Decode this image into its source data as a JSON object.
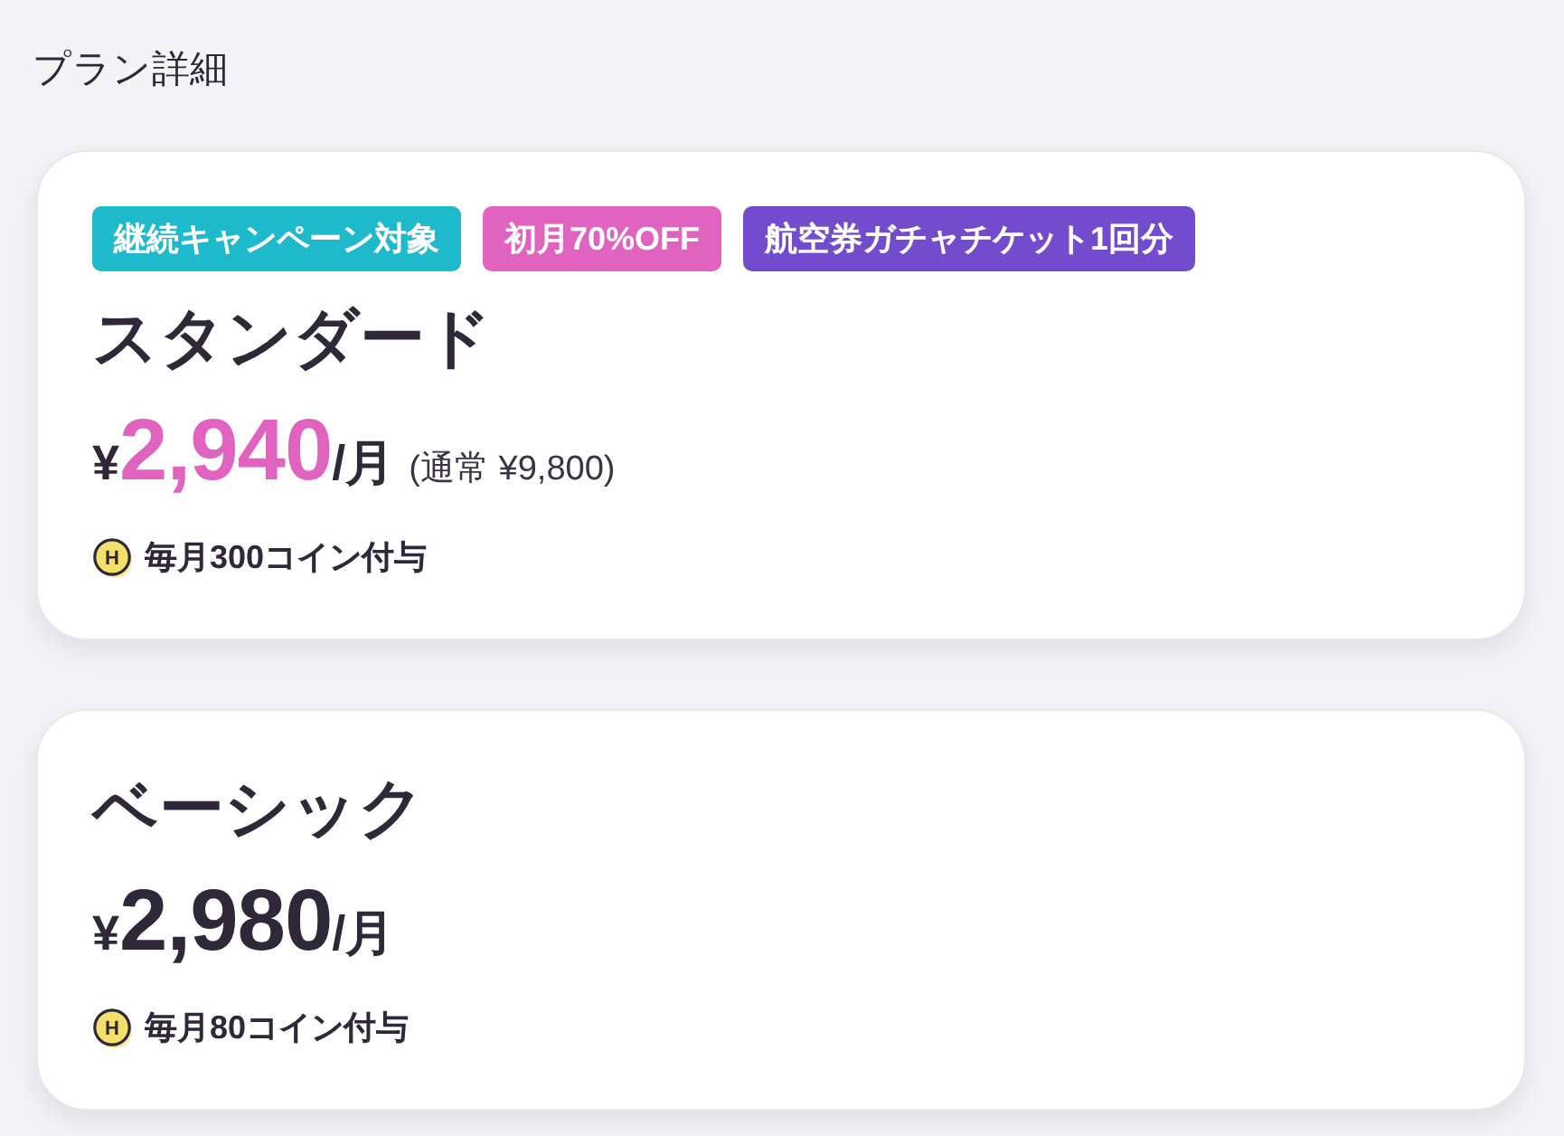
{
  "heading": "プラン詳細",
  "plans": [
    {
      "tags": [
        {
          "label": "継続キャンペーン対象",
          "color": "#1fb9cc"
        },
        {
          "label": "初月70%OFF",
          "color": "#e063c0"
        },
        {
          "label": "航空券ガチャチケット1回分",
          "color": "#724ccc"
        }
      ],
      "name": "スタンダード",
      "currency": "¥",
      "amount": "2,940",
      "discounted": true,
      "unit": "/月",
      "regular_price": "(通常 ¥9,800)",
      "coin_mark": "H",
      "coin_text": "毎月300コイン付与"
    },
    {
      "name": "ベーシック",
      "currency": "¥",
      "amount": "2,980",
      "discounted": false,
      "unit": "/月",
      "coin_mark": "H",
      "coin_text": "毎月80コイン付与"
    }
  ]
}
